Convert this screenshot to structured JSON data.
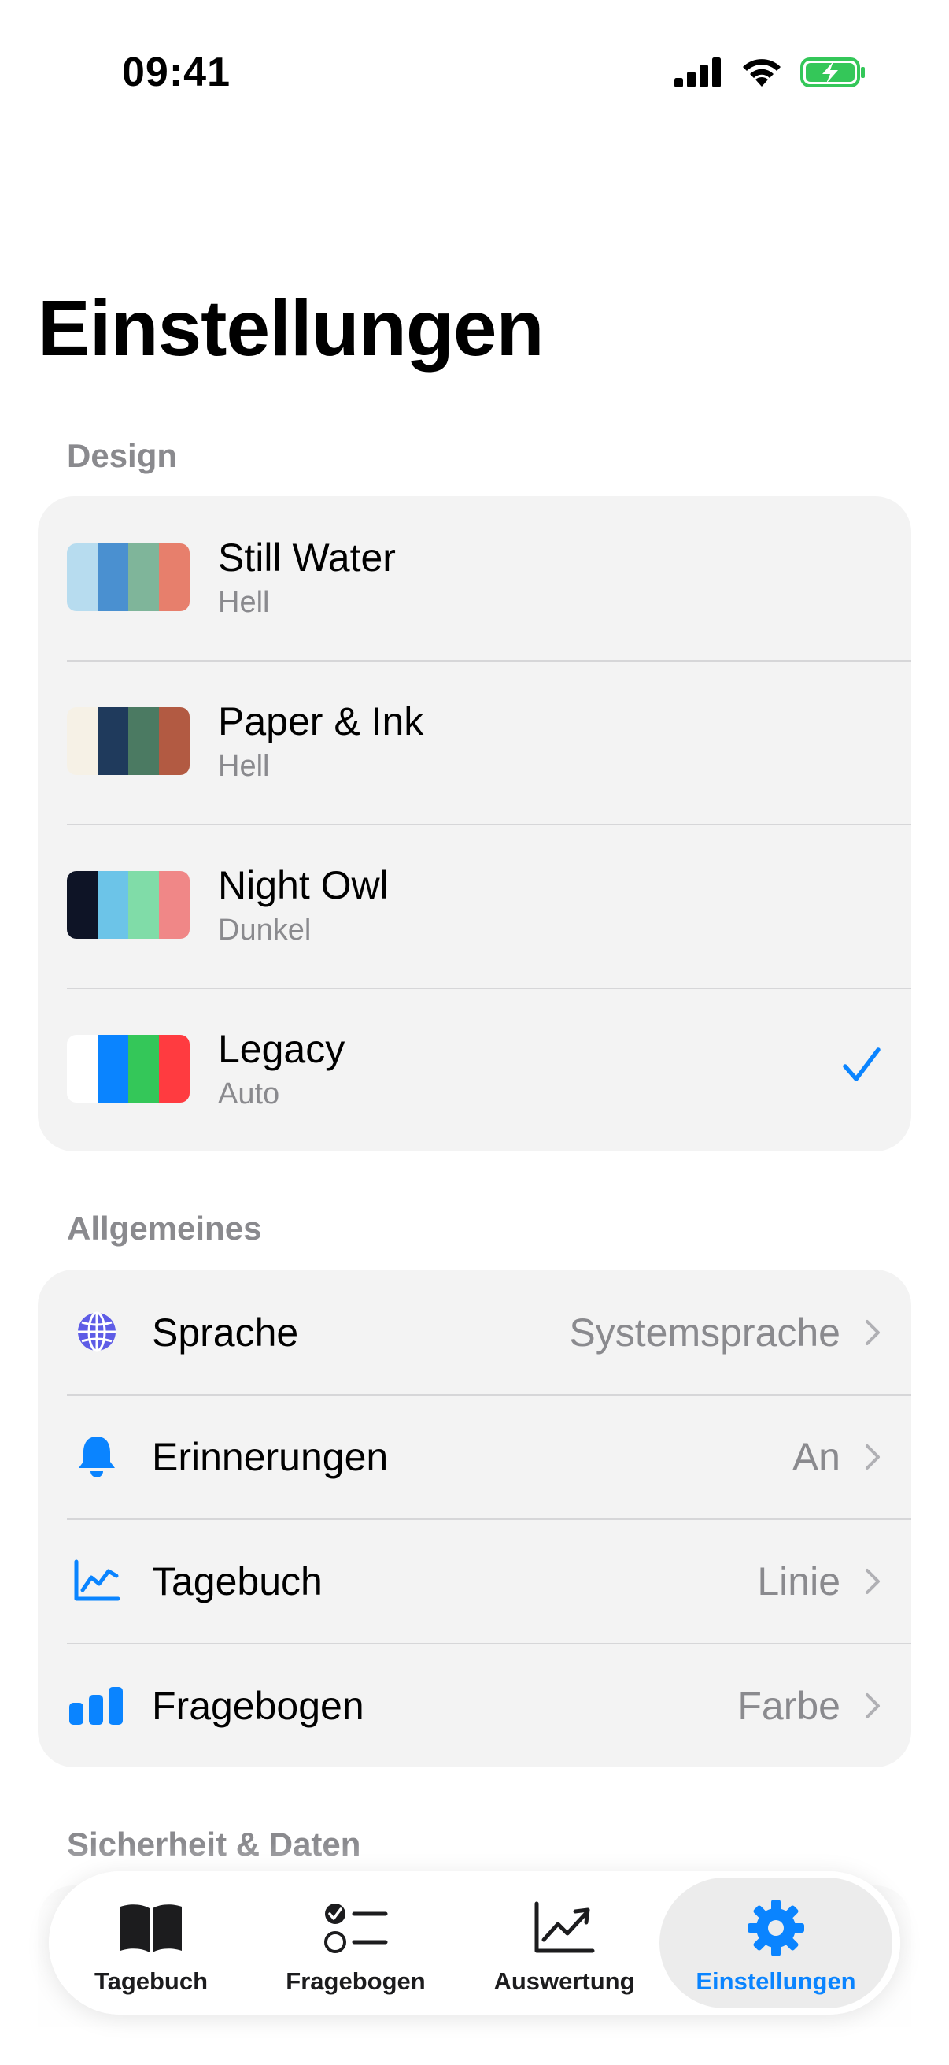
{
  "status_bar": {
    "time": "09:41"
  },
  "page": {
    "title": "Einstellungen"
  },
  "design": {
    "header": "Design",
    "themes": [
      {
        "name": "Still Water",
        "mode": "Hell",
        "colors": [
          "#b7dcef",
          "#4a90d0",
          "#7fb59a",
          "#e77f6c"
        ],
        "selected": false
      },
      {
        "name": "Paper & Ink",
        "mode": "Hell",
        "colors": [
          "#f6f1e6",
          "#1f3a5c",
          "#4b7a62",
          "#b25a42"
        ],
        "selected": false
      },
      {
        "name": "Night Owl",
        "mode": "Dunkel",
        "colors": [
          "#0e1426",
          "#6cc4e8",
          "#80dca8",
          "#f08787"
        ],
        "selected": false
      },
      {
        "name": "Legacy",
        "mode": "Auto",
        "colors": [
          "#ffffff",
          "#0a84ff",
          "#34c759",
          "#ff3b40"
        ],
        "selected": true
      }
    ]
  },
  "general": {
    "header": "Allgemeines",
    "items": [
      {
        "label": "Sprache",
        "value": "Systemsprache",
        "icon": "globe-icon"
      },
      {
        "label": "Erinnerungen",
        "value": "An",
        "icon": "bell-icon"
      },
      {
        "label": "Tagebuch",
        "value": "Linie",
        "icon": "line-chart-icon"
      },
      {
        "label": "Fragebogen",
        "value": "Farbe",
        "icon": "bar-chart-icon"
      }
    ]
  },
  "security": {
    "header": "Sicherheit & Daten"
  },
  "tab_bar": {
    "tabs": [
      {
        "label": "Tagebuch",
        "icon": "book-icon",
        "active": false
      },
      {
        "label": "Fragebogen",
        "icon": "checklist-icon",
        "active": false
      },
      {
        "label": "Auswertung",
        "icon": "trend-chart-icon",
        "active": false
      },
      {
        "label": "Einstellungen",
        "icon": "gear-icon",
        "active": true
      }
    ]
  },
  "colors": {
    "accent": "#0a84ff",
    "secondary_text": "#8a8a8e",
    "card_background": "#f3f3f3",
    "battery_green": "#34c759"
  }
}
